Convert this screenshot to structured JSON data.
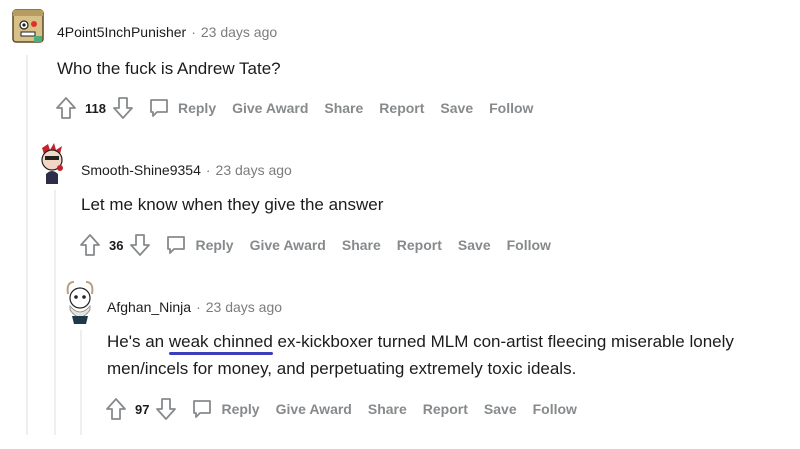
{
  "comments": [
    {
      "username": "4Point5InchPunisher",
      "time": "23 days ago",
      "text": "Who the fuck is Andrew Tate?",
      "score": "118",
      "actions": {
        "reply": "Reply",
        "award": "Give Award",
        "share": "Share",
        "report": "Report",
        "save": "Save",
        "follow": "Follow"
      }
    },
    {
      "username": "Smooth-Shine9354",
      "time": "23 days ago",
      "text": "Let me know when they give the answer",
      "score": "36",
      "actions": {
        "reply": "Reply",
        "award": "Give Award",
        "share": "Share",
        "report": "Report",
        "save": "Save",
        "follow": "Follow"
      }
    },
    {
      "username": "Afghan_Ninja",
      "time": "23 days ago",
      "text_before": "He's an ",
      "text_highlight": "weak chinned",
      "text_after": " ex-kickboxer turned MLM con-artist fleecing miserable lonely men/incels for money, and perpetuating extremely toxic ideals.",
      "score": "97",
      "actions": {
        "reply": "Reply",
        "award": "Give Award",
        "share": "Share",
        "report": "Report",
        "save": "Save",
        "follow": "Follow"
      }
    }
  ],
  "separator": "·",
  "colors": {
    "meta": "#7c7c7c",
    "action": "#878a8c",
    "underline": "#3b3fbd",
    "thread_line": "#edeff1"
  }
}
